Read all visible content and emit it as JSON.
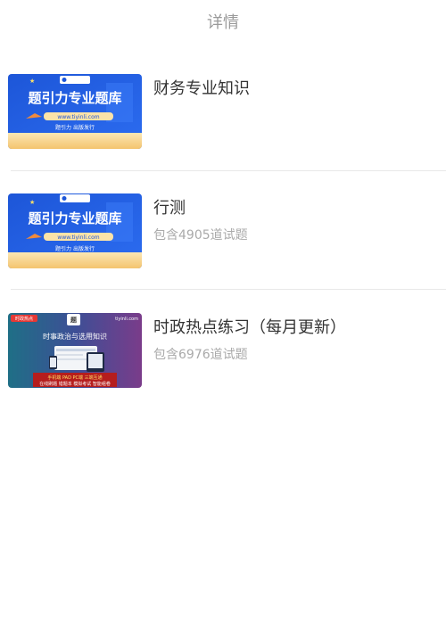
{
  "header": {
    "title": "详情"
  },
  "items": [
    {
      "title": "财务专业知识",
      "count": "",
      "thumb": {
        "headline": "题引力专业题库",
        "url": "www.tiyinli.com",
        "tagline": "题引力 出版发行",
        "logo_text": "题引力"
      }
    },
    {
      "title": "行测",
      "count": "包含4905道试题",
      "thumb": {
        "headline": "题引力专业题库",
        "url": "www.tiyinli.com",
        "tagline": "题引力 出版发行",
        "logo_text": "题引力"
      }
    },
    {
      "title": "时政热点练习（每月更新）",
      "count": "包含6976道试题",
      "thumb": {
        "badge": "时政热点",
        "site": "tiyinli.com",
        "headline": "时事政治与选用知识",
        "banner_line1": "手机端 PAD PC端 三端互通",
        "banner_line2": "在线刷题 错题本 模拟考试 智能组卷"
      }
    }
  ]
}
